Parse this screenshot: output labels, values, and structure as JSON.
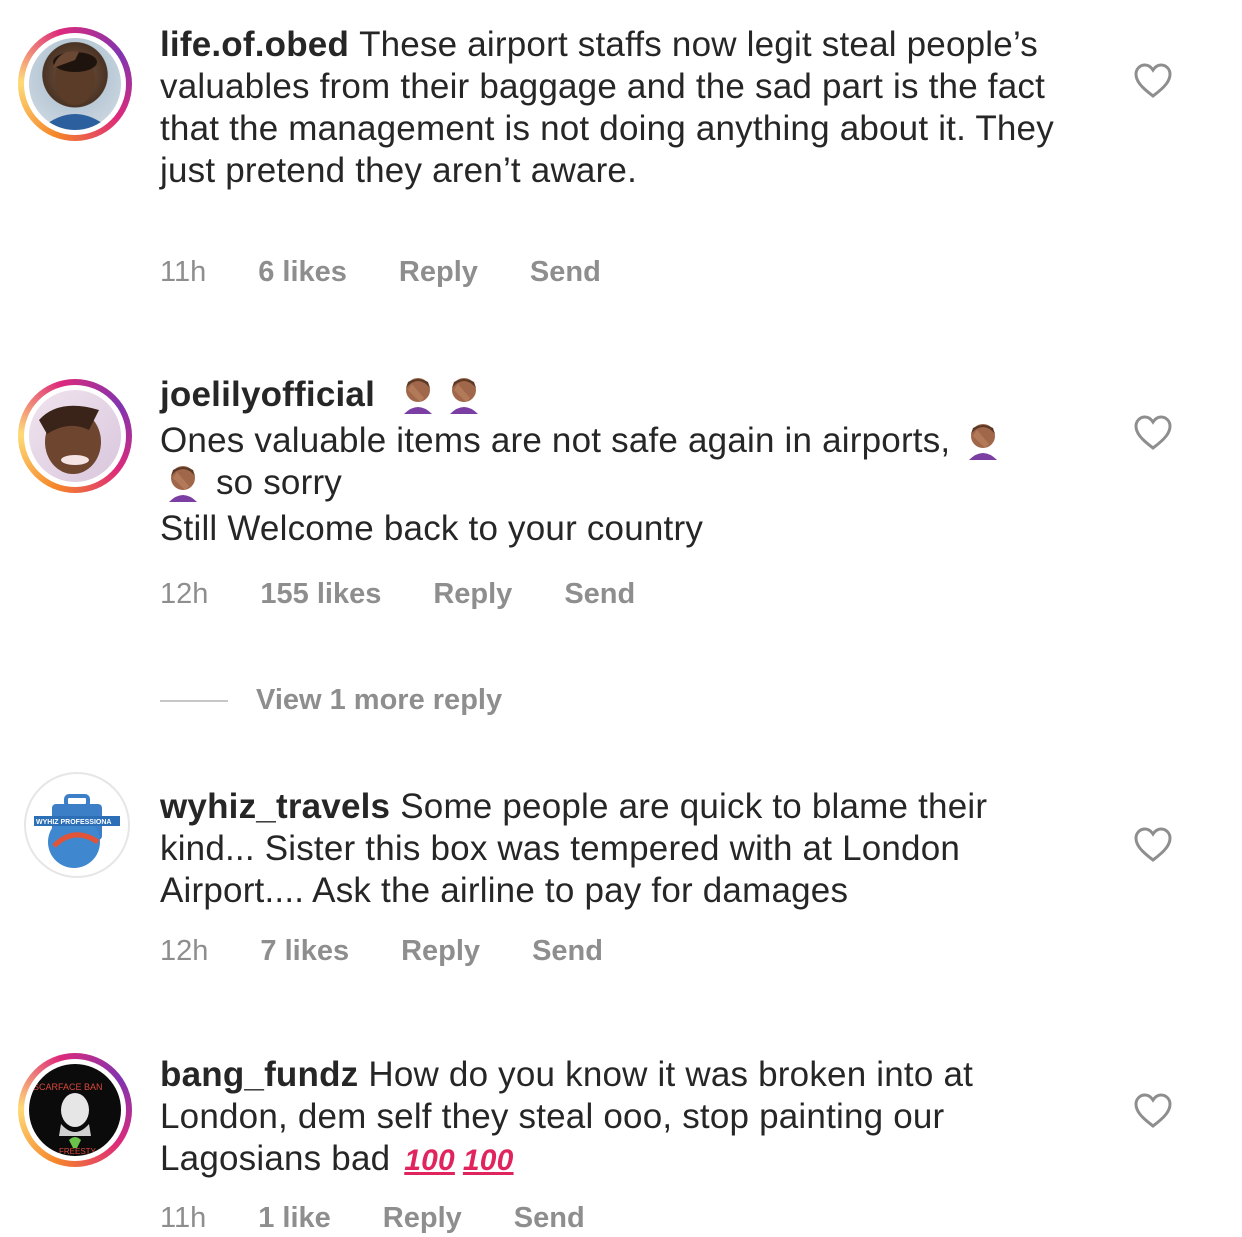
{
  "comments": [
    {
      "username": "life.of.obed",
      "text": "These airport staffs now legit steal people’s valuables from their baggage and the sad part is the fact that the management is not doing anything about it. They just pretend they aren’t aware.",
      "time": "11h",
      "likes": "6 likes",
      "reply": "Reply",
      "send": "Send"
    },
    {
      "username": "joelilyofficial",
      "line1": "Ones valuable items are not safe again in airports,",
      "line2": "so sorry",
      "line3": "Still Welcome back to your country",
      "time": "12h",
      "likes": "155 likes",
      "reply": "Reply",
      "send": "Send"
    },
    {
      "username": "wyhiz_travels",
      "text": "Some people are quick to blame their kind... Sister this box was tempered with at London Airport.... Ask the airline to pay for damages",
      "avatar_text": "WYHIZ PROFESSIONA",
      "time": "12h",
      "likes": "7 likes",
      "reply": "Reply",
      "send": "Send"
    },
    {
      "username": "bang_fundz",
      "text": "How do you know it was broken into at London, dem self they steal ooo, stop painting our Lagosians bad",
      "emoji": "100",
      "avatar_text": "SCARFACE BAN",
      "avatar_text2": "FREESTY",
      "time": "11h",
      "likes": "1 like",
      "reply": "Reply",
      "send": "Send"
    }
  ],
  "view_more_replies": "View 1 more reply",
  "colors": {
    "meta": "#8e8e8e",
    "text": "#262626",
    "hundred": "#e0245e"
  }
}
